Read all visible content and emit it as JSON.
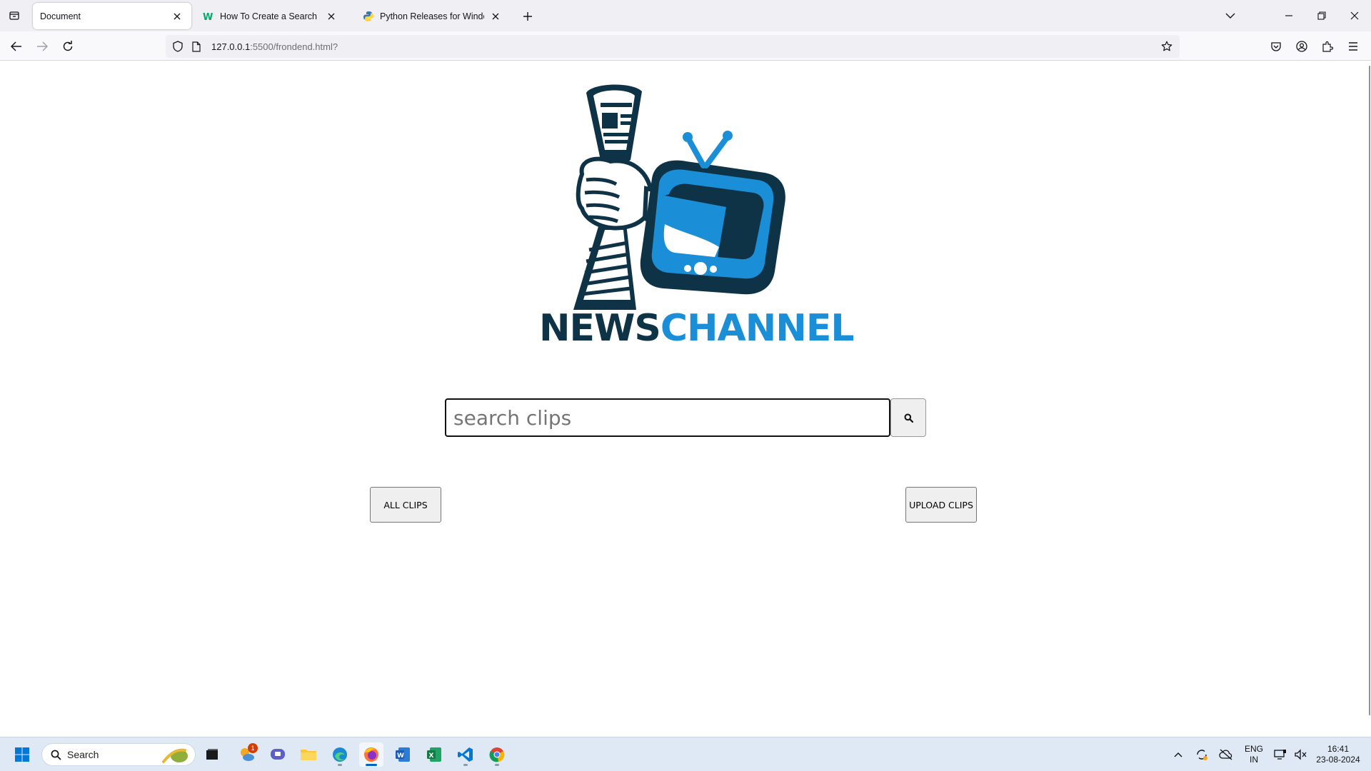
{
  "browser": {
    "tabs": [
      {
        "title": "Document",
        "active": true
      },
      {
        "title": "How To Create a Search Button",
        "active": false
      },
      {
        "title": "Python Releases for Windows |",
        "active": false
      }
    ],
    "url_host": "127.0.0.1",
    "url_rest": ":5500/frondend.html?"
  },
  "page": {
    "brand_part1": "NEWS",
    "brand_part2": "CHANNEL",
    "search_placeholder": "search clips",
    "all_clips_label": "ALL CLIPS",
    "upload_clips_label": "UPLOAD CLIPS"
  },
  "taskbar": {
    "search_label": "Search",
    "notification_badge": "1",
    "language_line1": "ENG",
    "language_line2": "IN",
    "time": "16:41",
    "date": "23-08-2024"
  },
  "colors": {
    "brand_dark": "#0e3246",
    "brand_blue": "#1a8fd8",
    "taskbar_bg": "#dfe9f5",
    "accent": "#0067c0"
  }
}
